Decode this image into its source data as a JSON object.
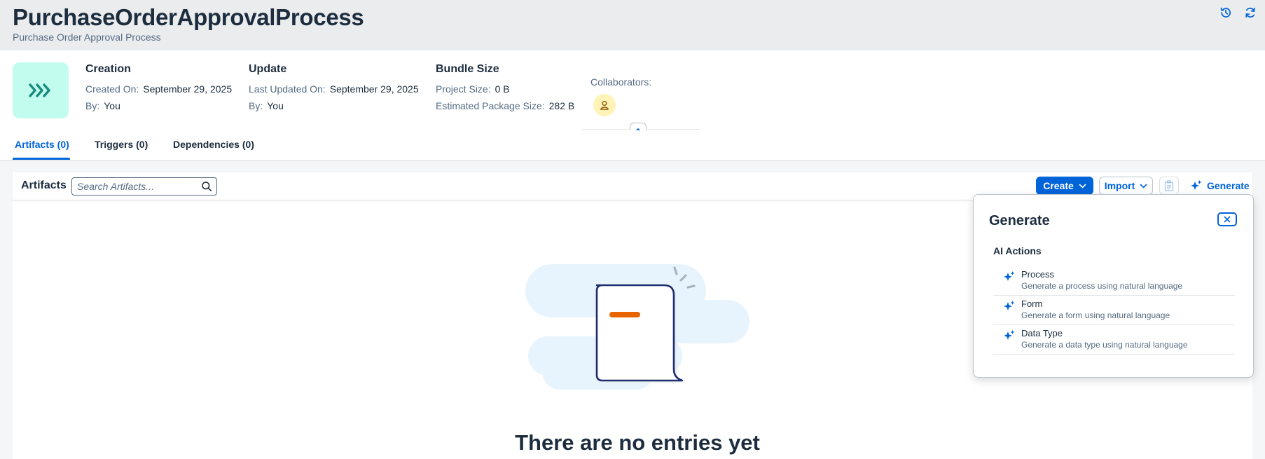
{
  "header": {
    "title": "PurchaseOrderApprovalProcess",
    "subtitle": "Purchase Order Approval Process",
    "actions": [
      "history-icon",
      "refresh-icon"
    ]
  },
  "info": {
    "creation": {
      "heading": "Creation",
      "created_on_label": "Created On:",
      "created_on_value": "September 29, 2025",
      "by_label": "By:",
      "by_value": "You"
    },
    "update": {
      "heading": "Update",
      "last_updated_label": "Last Updated On:",
      "last_updated_value": "September 29, 2025",
      "by_label": "By:",
      "by_value": "You"
    },
    "bundle": {
      "heading": "Bundle Size",
      "project_size_label": "Project Size:",
      "project_size_value": "0 B",
      "package_size_label": "Estimated Package Size:",
      "package_size_value": "282 B"
    },
    "collaborators_label": "Collaborators:"
  },
  "tabs": [
    {
      "label": "Artifacts (0)",
      "active": true
    },
    {
      "label": "Triggers (0)",
      "active": false
    },
    {
      "label": "Dependencies (0)",
      "active": false
    }
  ],
  "artifacts": {
    "title": "Artifacts",
    "search_placeholder": "Search Artifacts...",
    "create_label": "Create",
    "import_label": "Import",
    "generate_label": "Generate",
    "empty_title": "There are no entries yet"
  },
  "generate_popover": {
    "title": "Generate",
    "section_heading": "AI Actions",
    "items": [
      {
        "title": "Process",
        "description": "Generate a process using natural language"
      },
      {
        "title": "Form",
        "description": "Generate a form using natural language"
      },
      {
        "title": "Data Type",
        "description": "Generate a data type using natural language"
      }
    ]
  },
  "colors": {
    "accent": "#0064d9",
    "title_bar_bg": "#eaecee",
    "project_icon_bg": "#c2fcee",
    "avatar_bg": "#fff3b8",
    "illustration_orange": "#e76500"
  }
}
